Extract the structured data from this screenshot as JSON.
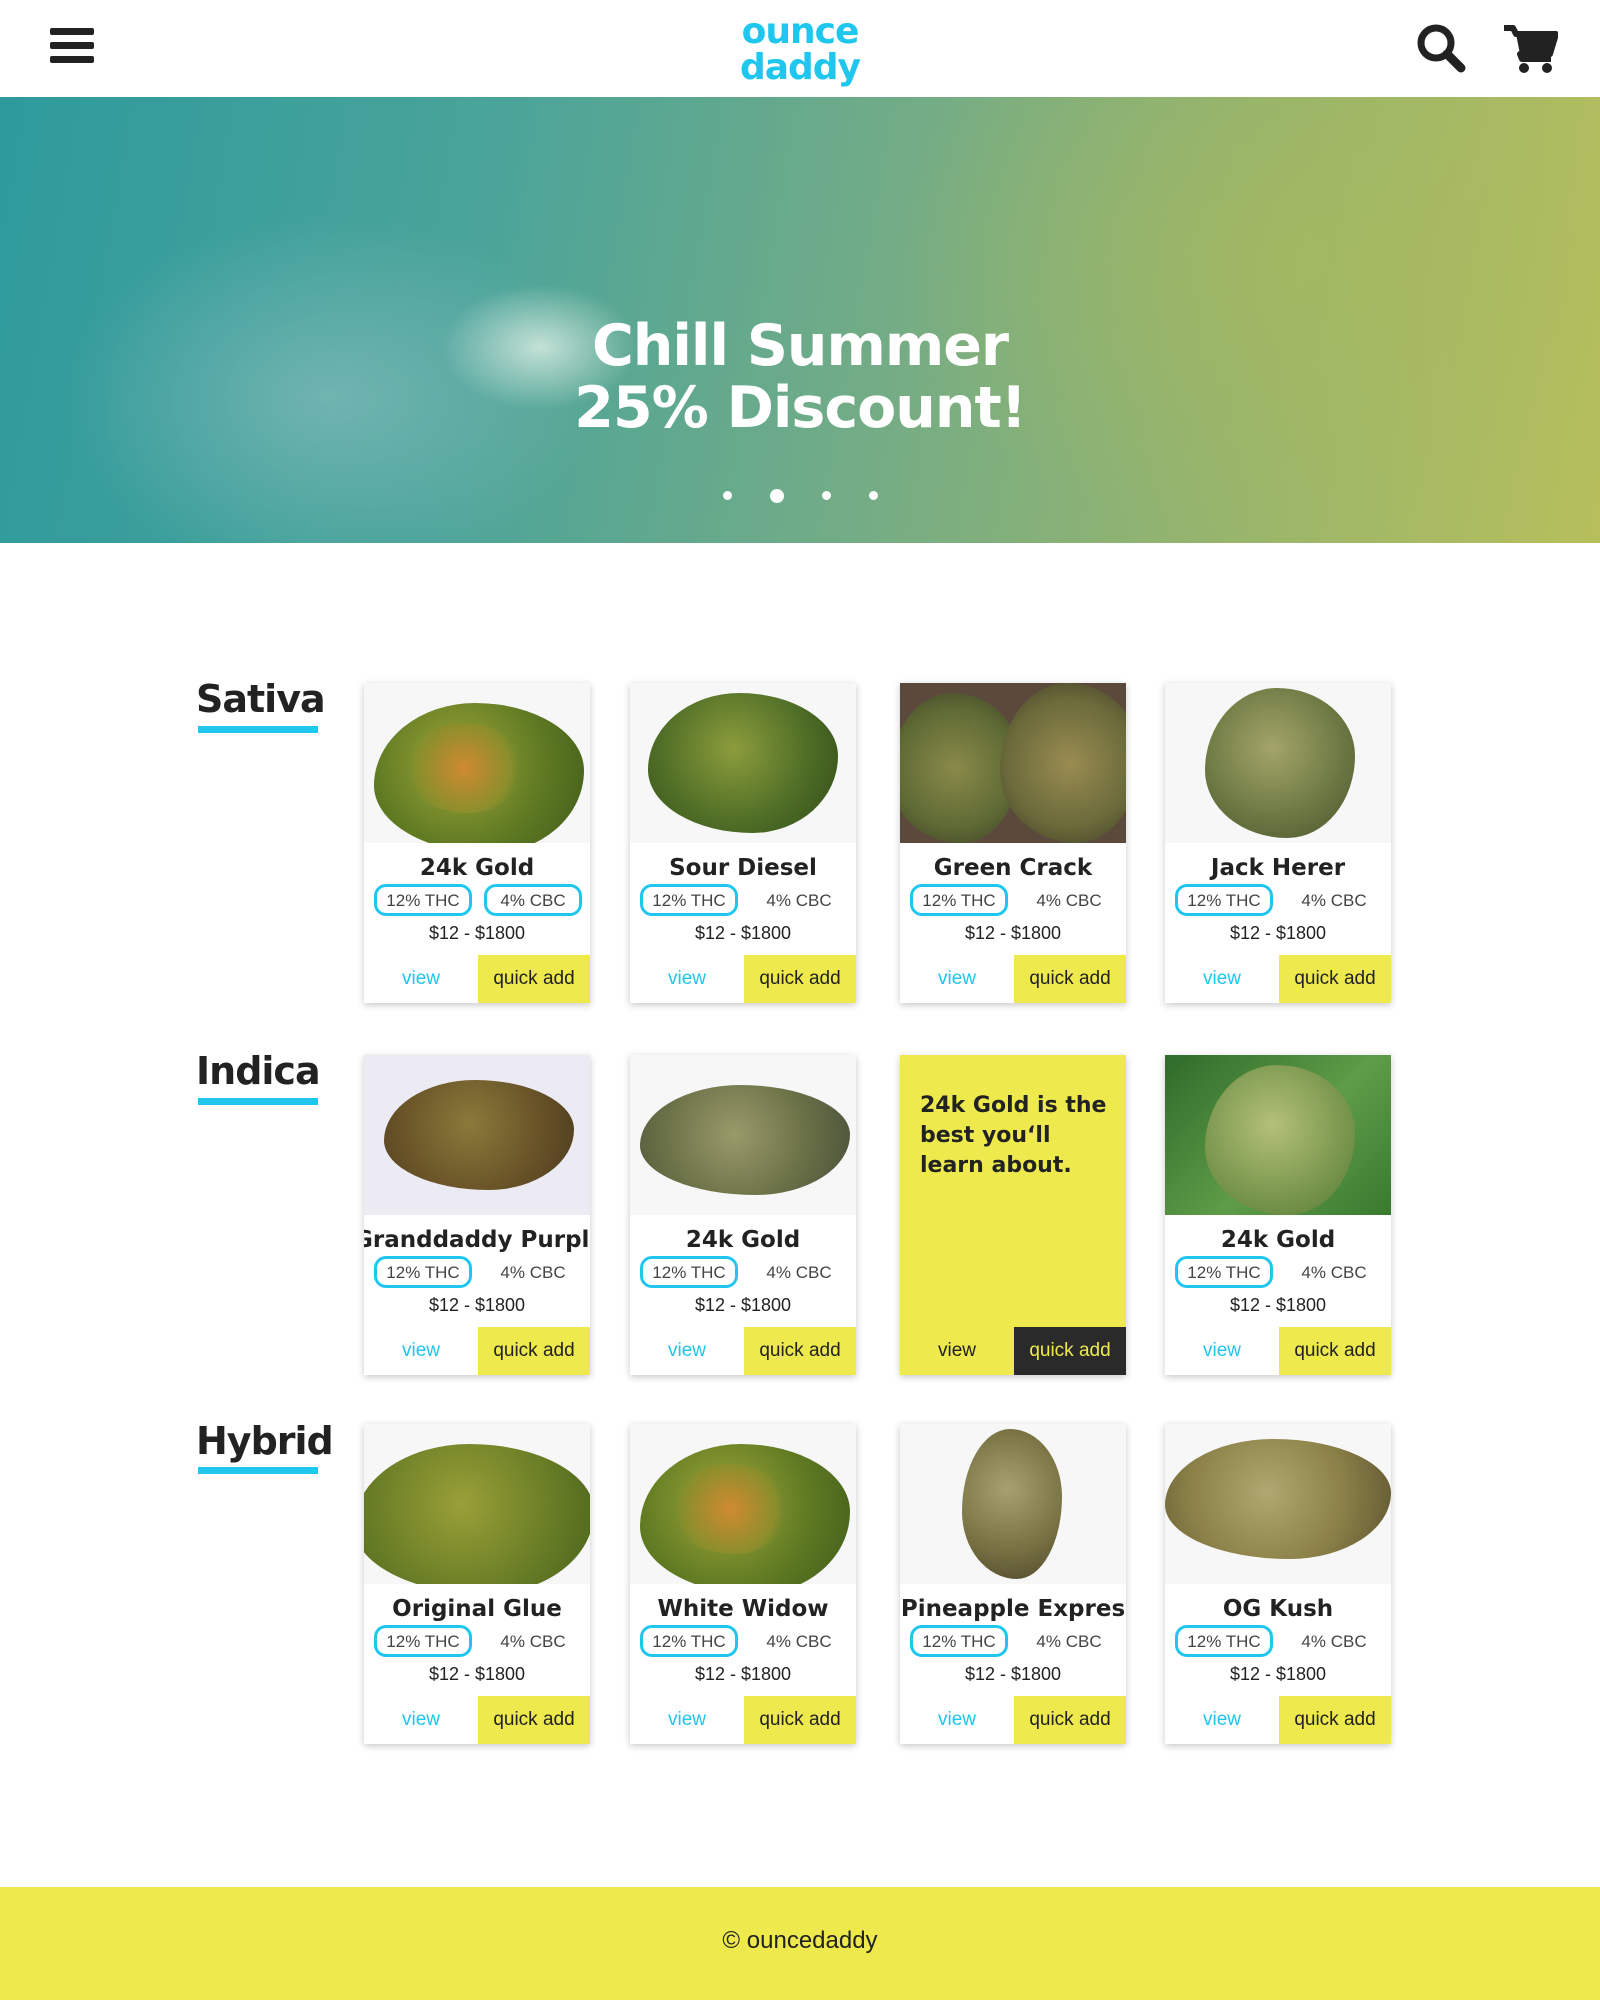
{
  "header": {
    "logo_line1": "ounce",
    "logo_line2": "daddy",
    "menu_icon": "hamburger-menu-icon",
    "search_icon": "search-icon",
    "cart_icon": "shopping-cart-icon",
    "brand_color": "#1fc6ee"
  },
  "hero": {
    "title_line1": "Chill Summer",
    "title_line2": "25% Discount!",
    "slide_count": 4,
    "active_slide": 2
  },
  "categories": [
    {
      "label": "Sativa",
      "products": [
        {
          "name": "24k Gold",
          "thc": "12% THC",
          "cbc": "4% CBC",
          "price": "$12 - $1800",
          "view": "view",
          "quick_add": "quick add"
        },
        {
          "name": "Sour Diesel",
          "thc": "12% THC",
          "cbc": "4% CBC",
          "price": "$12 - $1800",
          "view": "view",
          "quick_add": "quick add"
        },
        {
          "name": "Green Crack",
          "thc": "12% THC",
          "cbc": "4% CBC",
          "price": "$12 - $1800",
          "view": "view",
          "quick_add": "quick add"
        },
        {
          "name": "Jack Herer",
          "thc": "12% THC",
          "cbc": "4% CBC",
          "price": "$12 - $1800",
          "view": "view",
          "quick_add": "quick add"
        }
      ]
    },
    {
      "label": "Indica",
      "products": [
        {
          "name": "Granddaddy Purple",
          "thc": "12% THC",
          "cbc": "4% CBC",
          "price": "$12 - $1800",
          "view": "view",
          "quick_add": "quick add"
        },
        {
          "name": "24k Gold",
          "thc": "12% THC",
          "cbc": "4% CBC",
          "price": "$12 - $1800",
          "view": "view",
          "quick_add": "quick add"
        },
        {
          "promo_text": "24k Gold is the best you‘ll learn about.",
          "view": "view",
          "quick_add": "quick add"
        },
        {
          "name": "24k Gold",
          "thc": "12% THC",
          "cbc": "4% CBC",
          "price": "$12 - $1800",
          "view": "view",
          "quick_add": "quick add"
        }
      ]
    },
    {
      "label": "Hybrid",
      "products": [
        {
          "name": "Original Glue",
          "thc": "12% THC",
          "cbc": "4% CBC",
          "price": "$12 - $1800",
          "view": "view",
          "quick_add": "quick add"
        },
        {
          "name": "White Widow",
          "thc": "12% THC",
          "cbc": "4% CBC",
          "price": "$12 - $1800",
          "view": "view",
          "quick_add": "quick add"
        },
        {
          "name": "Pineapple Expres",
          "thc": "12% THC",
          "cbc": "4% CBC",
          "price": "$12 - $1800",
          "view": "view",
          "quick_add": "quick add"
        },
        {
          "name": "OG Kush",
          "thc": "12% THC",
          "cbc": "4% CBC",
          "price": "$12 - $1800",
          "view": "view",
          "quick_add": "quick add"
        }
      ]
    }
  ],
  "footer": {
    "text": "© ouncedaddy"
  },
  "colors": {
    "accent_cyan": "#1fc6ee",
    "accent_yellow": "#eeea4d",
    "dark": "#222222"
  }
}
